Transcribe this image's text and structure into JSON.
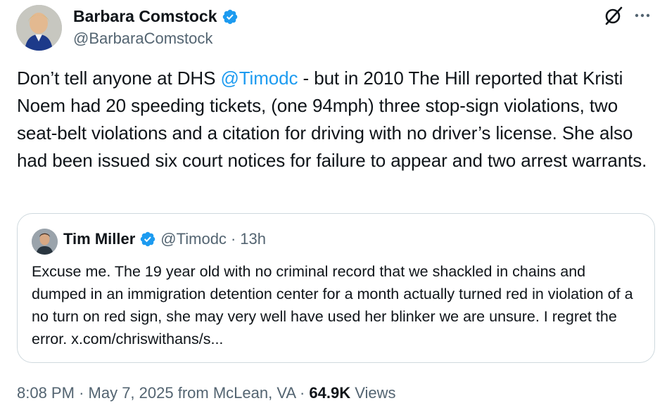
{
  "author": {
    "name": "Barbara Comstock",
    "handle": "@BarbaraComstock"
  },
  "tweet": {
    "text_before_mention": "Don’t tell anyone at DHS ",
    "mention": "@Timodc",
    "text_after_mention": " -  but in 2010 The Hill reported that Kristi Noem had 20 speeding tickets, (one 94mph) three stop-sign violations, two seat-belt violations and a citation for driving with no driver’s license. She also had been issued six court notices for failure to appear and two arrest warrants."
  },
  "quote": {
    "name": "Tim Miller",
    "handle": "@Timodc",
    "separator": "·",
    "time": "13h",
    "text": "Excuse me. The 19 year old with no criminal record that we shackled in chains and dumped in an immigration detention center for a month actually turned red in violation of a no turn on red sign, she may very well have used her blinker we are unsure. I regret the error. x.com/chriswithans/s..."
  },
  "footer": {
    "time": "8:08 PM",
    "separator1": "·",
    "date": "May 7, 2025",
    "location": "from McLean, VA",
    "separator2": "·",
    "views_count": "64.9K",
    "views_label": "Views"
  },
  "icons": {
    "verified": "verified-badge-icon",
    "grok": "grok-icon",
    "more": "more-options-icon"
  },
  "colors": {
    "accent": "#1d9bf0",
    "text": "#0f1419",
    "muted": "#536471",
    "border": "#cfd9de"
  }
}
